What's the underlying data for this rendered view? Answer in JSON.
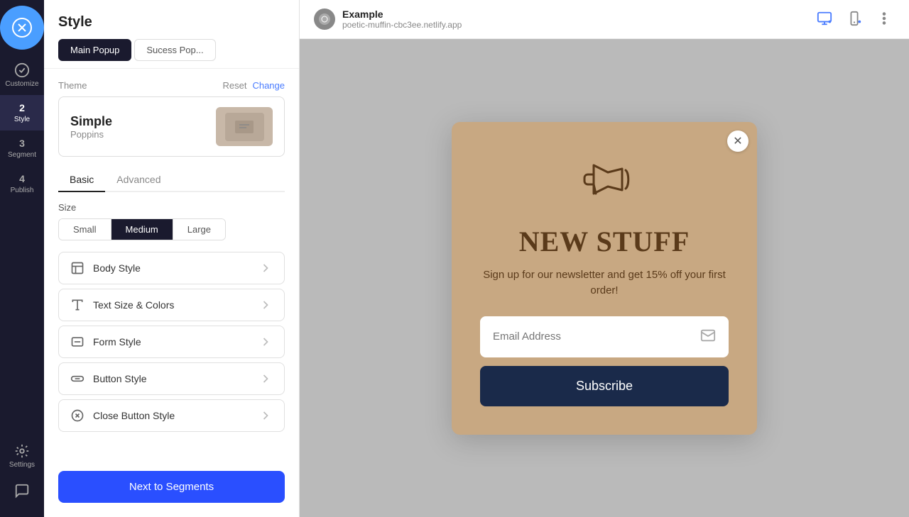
{
  "sidebar": {
    "logo_alt": "App Logo",
    "nav_items": [
      {
        "id": "customize",
        "label": "Customize",
        "num": null,
        "icon": "check-icon",
        "active": false
      },
      {
        "id": "style",
        "label": "Style",
        "num": "2",
        "active": true
      },
      {
        "id": "segment",
        "label": "Segment",
        "num": "3",
        "active": false
      },
      {
        "id": "publish",
        "label": "Publish",
        "num": "4",
        "active": false
      }
    ],
    "settings_label": "Settings",
    "chat_label": "Chat"
  },
  "panel": {
    "title": "Style",
    "tabs": [
      {
        "id": "main-popup",
        "label": "Main Popup",
        "active": true
      },
      {
        "id": "sucess-popup",
        "label": "Sucess Pop...",
        "active": false
      }
    ],
    "theme": {
      "section_label": "Theme",
      "reset_label": "Reset",
      "change_label": "Change",
      "name": "Simple",
      "sub": "Poppins"
    },
    "style_tabs": [
      {
        "id": "basic",
        "label": "Basic",
        "active": true
      },
      {
        "id": "advanced",
        "label": "Advanced",
        "active": false
      }
    ],
    "size": {
      "label": "Size",
      "options": [
        {
          "id": "small",
          "label": "Small",
          "active": false
        },
        {
          "id": "medium",
          "label": "Medium",
          "active": true
        },
        {
          "id": "large",
          "label": "Large",
          "active": false
        }
      ]
    },
    "style_items": [
      {
        "id": "body-style",
        "label": "Body Style",
        "icon": "layout-icon"
      },
      {
        "id": "text-size-colors",
        "label": "Text Size & Colors",
        "icon": "text-icon"
      },
      {
        "id": "form-style",
        "label": "Form Style",
        "icon": "form-icon"
      },
      {
        "id": "button-style",
        "label": "Button Style",
        "icon": "button-icon"
      },
      {
        "id": "close-button-style",
        "label": "Close Button Style",
        "icon": "close-btn-icon"
      }
    ],
    "next_button_label": "Next to Segments"
  },
  "topbar": {
    "site_name": "Example",
    "site_url": "poetic-muffin-cbc3ee.netlify.app",
    "device_desktop_label": "Desktop view",
    "device_mobile_label": "Mobile view",
    "more_label": "More options"
  },
  "popup": {
    "icon_alt": "Megaphone icon",
    "title": "NEW STUFF",
    "description": "Sign up for our newsletter and get 15% off your first order!",
    "email_placeholder": "Email Address",
    "subscribe_label": "Subscribe",
    "close_label": "Close popup"
  },
  "colors": {
    "sidebar_bg": "#1a1a2e",
    "panel_bg": "#ffffff",
    "preview_bg": "#d0d0d0",
    "popup_bg": "#c8a882",
    "popup_text": "#5a3a1a",
    "popup_btn_bg": "#1a2a4a",
    "next_btn_bg": "#3355ff",
    "active_tab_bg": "#1a1a2e",
    "medium_btn_bg": "#1a1a2e"
  }
}
